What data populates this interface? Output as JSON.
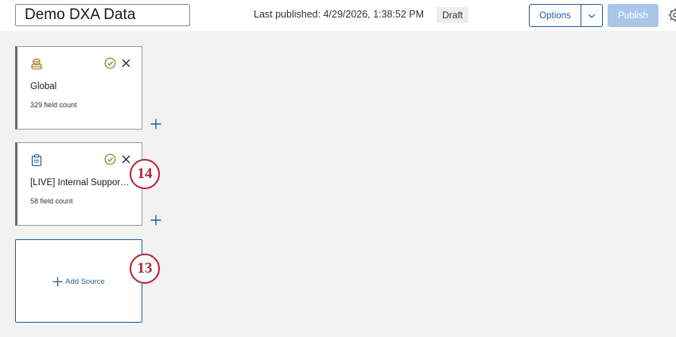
{
  "header": {
    "title_value": "Demo DXA Data",
    "last_published": "Last published: 4/29/2026, 1:38:52 PM",
    "status_badge": "Draft",
    "options_label": "Options",
    "publish_label": "Publish"
  },
  "sources": [
    {
      "name": "Global",
      "field_count": "329 field count",
      "icon": "database-stack-icon",
      "status_icon": "check-circle-icon"
    },
    {
      "name": "[LIVE] Internal Support Survey",
      "field_count": "58 field count",
      "icon": "clipboard-icon",
      "status_icon": "check-circle-icon"
    }
  ],
  "add_source_label": "Add Source",
  "markers": [
    "14",
    "13"
  ],
  "colors": {
    "accent": "#1e5f9e",
    "publish_disabled": "#a9c6e8",
    "success": "#5a9a2c",
    "database_icon": "#a8791a",
    "marker": "#b3243a"
  }
}
